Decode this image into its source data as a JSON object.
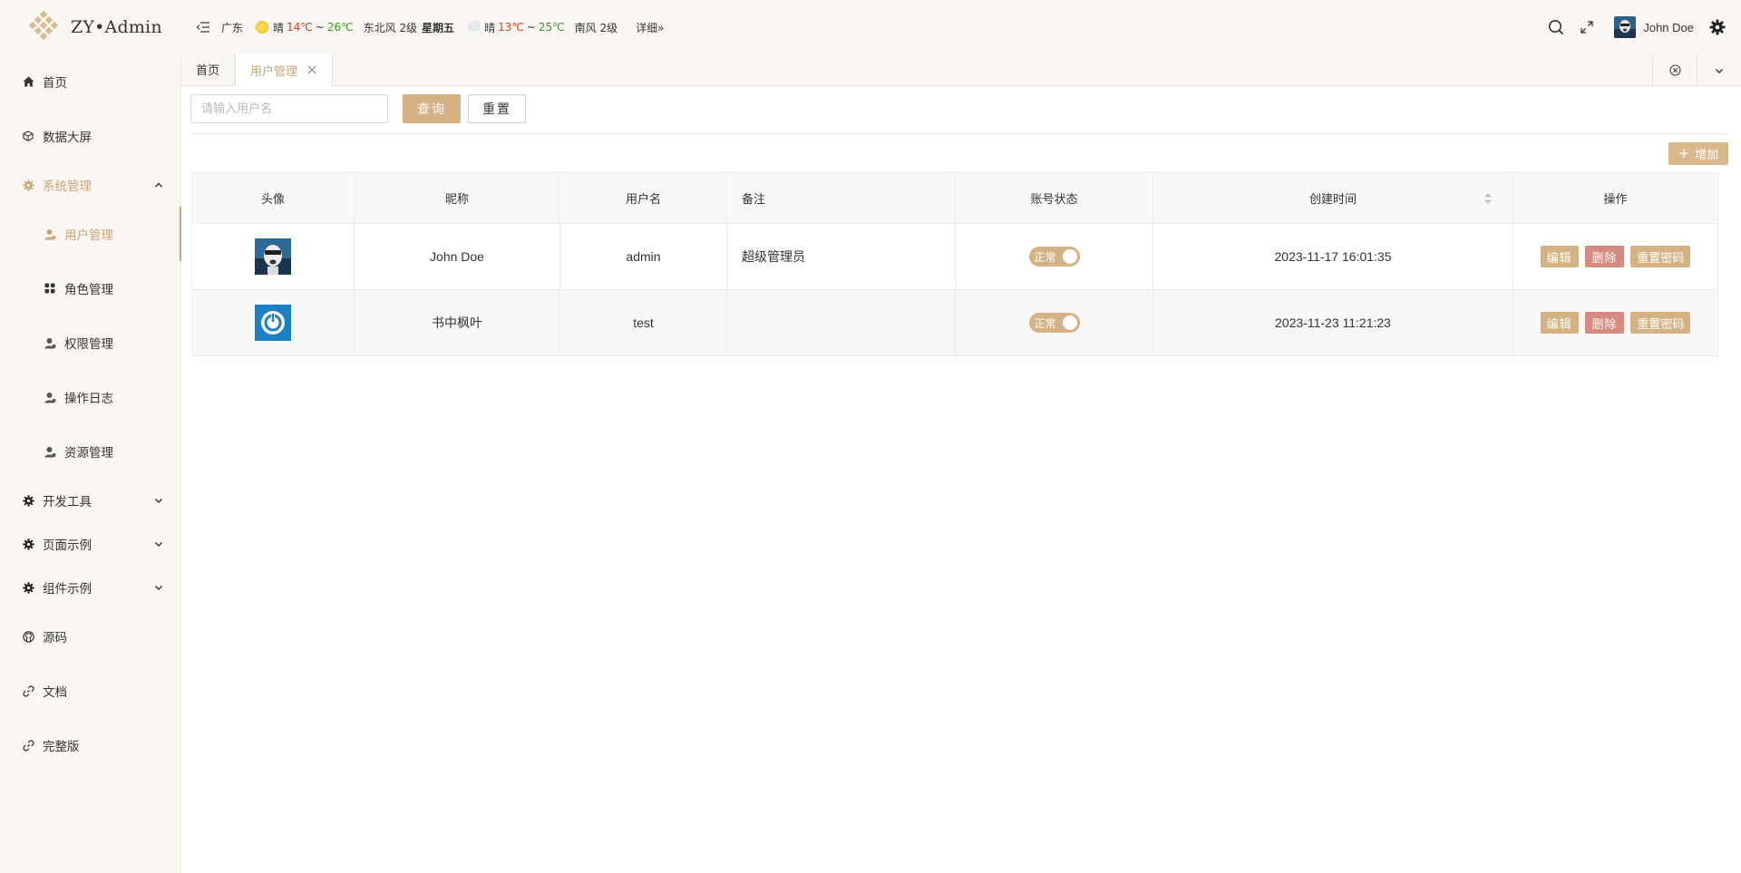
{
  "app": {
    "logo_text": "ZY•Admin"
  },
  "header": {
    "weather": {
      "city": "广东",
      "today": {
        "condition": "晴",
        "low": "14℃",
        "tilde": "~",
        "high": "26℃",
        "wind": "东北风 2级",
        "weekday": "星期五"
      },
      "tomorrow": {
        "condition": "晴",
        "low": "13℃",
        "tilde": "~",
        "high": "25℃",
        "wind": "南风 2级"
      },
      "detail_link": "详细»",
      "hot_color": "#d9401c",
      "cool_color": "#3c9a2a"
    },
    "user_name": "John Doe",
    "icons": [
      "menu-fold-icon",
      "search-icon",
      "fullscreen-icon",
      "gear-icon"
    ]
  },
  "sidebar": {
    "items": [
      {
        "label": "首页",
        "icon": "home-icon"
      },
      {
        "label": "数据大屏",
        "icon": "cube-icon"
      },
      {
        "label": "系统管理",
        "icon": "gear-icon",
        "expanded": true
      },
      {
        "label": "用户管理",
        "icon": "user-icon",
        "active": true
      },
      {
        "label": "角色管理",
        "icon": "grid-icon"
      },
      {
        "label": "权限管理",
        "icon": "user-icon"
      },
      {
        "label": "操作日志",
        "icon": "user-icon"
      },
      {
        "label": "资源管理",
        "icon": "user-icon"
      },
      {
        "label": "开发工具",
        "icon": "gear-icon"
      },
      {
        "label": "页面示例",
        "icon": "gear-icon"
      },
      {
        "label": "组件示例",
        "icon": "gear-icon"
      },
      {
        "label": "源码",
        "icon": "github-icon"
      },
      {
        "label": "文档",
        "icon": "link-icon"
      },
      {
        "label": "完整版",
        "icon": "link-icon"
      }
    ],
    "accent_color": "#c9a577"
  },
  "tabs": [
    {
      "label": "首页"
    },
    {
      "label": "用户管理",
      "active": true
    }
  ],
  "search": {
    "placeholder": "请输入用户名",
    "query_label": "查询",
    "reset_label": "重置",
    "add_label": "增加"
  },
  "table": {
    "columns": [
      "头像",
      "昵称",
      "用户名",
      "备注",
      "账号状态",
      "创建时间",
      "操作"
    ],
    "rows": [
      {
        "nickname": "John Doe",
        "username": "admin",
        "remark": "超级管理员",
        "status": "正常",
        "created": "2023-11-17 16:01:35"
      },
      {
        "nickname": "书中枫叶",
        "username": "test",
        "remark": "",
        "status": "正常",
        "created": "2023-11-23 11:21:23"
      }
    ],
    "actions": {
      "edit": "编辑",
      "delete": "删除",
      "reset_password": "重置密码"
    }
  }
}
